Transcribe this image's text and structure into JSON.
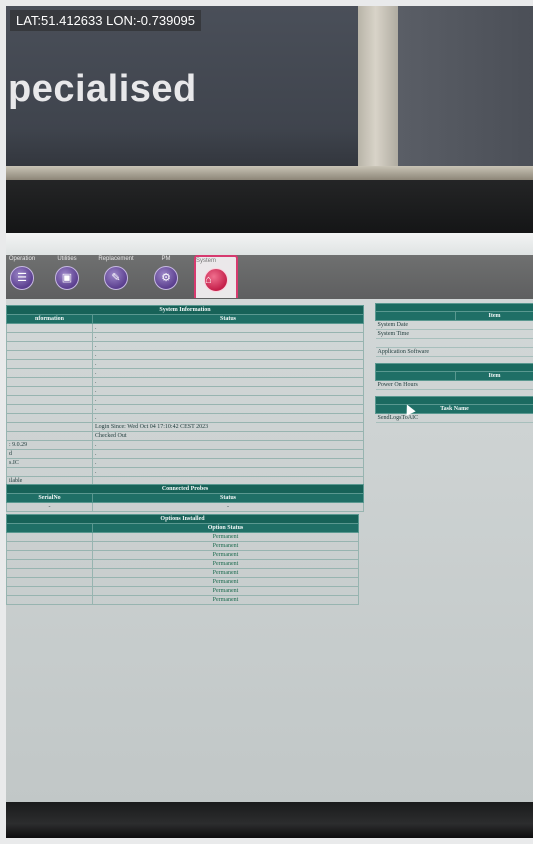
{
  "overlay": {
    "coords": "LAT:51.412633 LON:-0.739095"
  },
  "background": {
    "banner_text": "pecialised"
  },
  "nav": {
    "items": [
      {
        "label": "Operation",
        "icon": "list-icon"
      },
      {
        "label": "Utilities",
        "icon": "toolbox-icon"
      },
      {
        "label": "Replacement",
        "icon": "wrench-icon"
      },
      {
        "label": "PM",
        "icon": "maintenance-icon"
      }
    ],
    "active": {
      "label": "System",
      "icon": "home-icon"
    },
    "colors": {
      "accent": "#d63a6f",
      "icon_purple": "#5b3f8f",
      "table_header": "#1f6f66"
    }
  },
  "system_info": {
    "title": "System Information",
    "col1_header": "nformation",
    "col2_header": "Status",
    "rows": [
      [
        "",
        "."
      ],
      [
        "",
        "."
      ],
      [
        "",
        "."
      ],
      [
        "",
        "."
      ],
      [
        "",
        "."
      ],
      [
        "",
        "."
      ],
      [
        "",
        "."
      ],
      [
        "",
        "."
      ],
      [
        "",
        "."
      ],
      [
        "",
        "."
      ],
      [
        "",
        "."
      ],
      [
        "",
        "Login Since: Wed Oct 04 17:10:42 CEST 2023"
      ],
      [
        "",
        "Checked Out"
      ],
      [
        ": 9.0.29",
        "."
      ],
      [
        "d",
        "."
      ],
      [
        "s.IC",
        "."
      ],
      [
        "",
        "."
      ],
      [
        "ilable",
        ""
      ]
    ]
  },
  "probes": {
    "title": "Connected Probes",
    "col1_header": "SerialNo",
    "col2_header": "Status",
    "row": [
      "-",
      "-"
    ]
  },
  "options": {
    "title": "Options Installed",
    "col_header": "Option Status",
    "rows": [
      "Permanent",
      "Permanent",
      "Permanent",
      "Permanent",
      "Permanent",
      "Permanent",
      "Permanent",
      "Permanent"
    ]
  },
  "right": {
    "table1": {
      "header": "Item",
      "rows": [
        "System Date",
        "System Time",
        "",
        "Application Software"
      ]
    },
    "table2": {
      "header": "Item",
      "rows": [
        "Power On Hours"
      ]
    },
    "table3": {
      "header": "Task Name",
      "rows": [
        "SendLogsToAIC"
      ]
    }
  }
}
